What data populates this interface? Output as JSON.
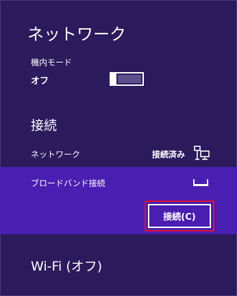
{
  "header": {
    "title": "ネットワーク"
  },
  "airplane_mode": {
    "label": "機内モード",
    "state": "オフ",
    "on": false
  },
  "connections": {
    "title": "接続",
    "items": [
      {
        "label": "ネットワーク",
        "status": "接続済み",
        "icon": "wired-network-icon"
      },
      {
        "label": "ブロードバンド接続",
        "status": "",
        "icon": "broadband-icon",
        "selected": true
      }
    ],
    "connect_button": "接続(C)"
  },
  "wifi": {
    "label": "Wi-Fi (オフ)"
  },
  "colors": {
    "background": "#2b1a5c",
    "selected": "#4a1eb1",
    "highlight": "#e0102e",
    "text": "#ffffff"
  }
}
